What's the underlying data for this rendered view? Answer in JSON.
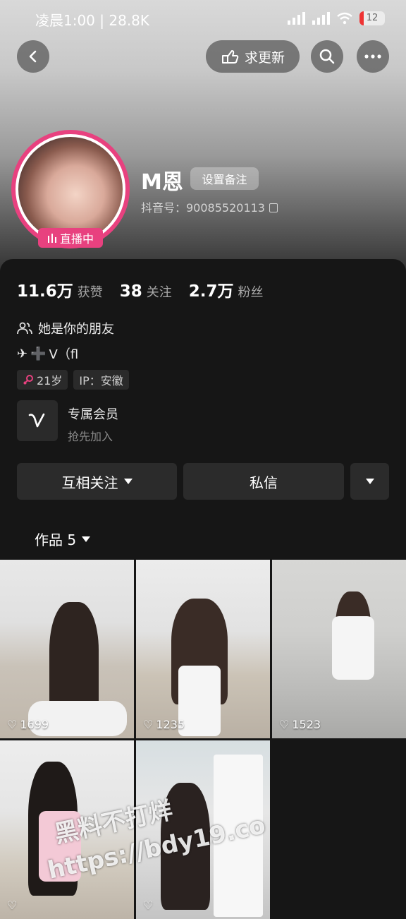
{
  "status_bar": {
    "time": "凌晨1:00 | 28.8K",
    "battery": "12"
  },
  "top_bar": {
    "request_update_label": "求更新"
  },
  "profile": {
    "name": "M恩",
    "remark_button": "设置备注",
    "douyin_id": "抖音号：90085520113",
    "live_badge": "直播中"
  },
  "stats": [
    {
      "value": "11.6万",
      "label": "获赞"
    },
    {
      "value": "38",
      "label": "关注"
    },
    {
      "value": "2.7万",
      "label": "粉丝"
    }
  ],
  "friend_text": "她是你的朋友",
  "bio": "V（fl",
  "tags": {
    "age": "21岁",
    "ip": "IP：安徽"
  },
  "vip": {
    "title": "专属会员",
    "subtitle": "抢先加入"
  },
  "actions": {
    "follow": "互相关注",
    "message": "私信"
  },
  "works_tab": "作品 5",
  "videos": [
    {
      "likes": "1699"
    },
    {
      "likes": "1235"
    },
    {
      "likes": "1523"
    },
    {
      "likes": ""
    },
    {
      "likes": ""
    }
  ],
  "watermark": {
    "line1": "黑料不打烊",
    "line2": "https://bdy19.co"
  },
  "colors": {
    "accent": "#e8417f",
    "panel": "#161616",
    "button": "#2b2b2b"
  }
}
